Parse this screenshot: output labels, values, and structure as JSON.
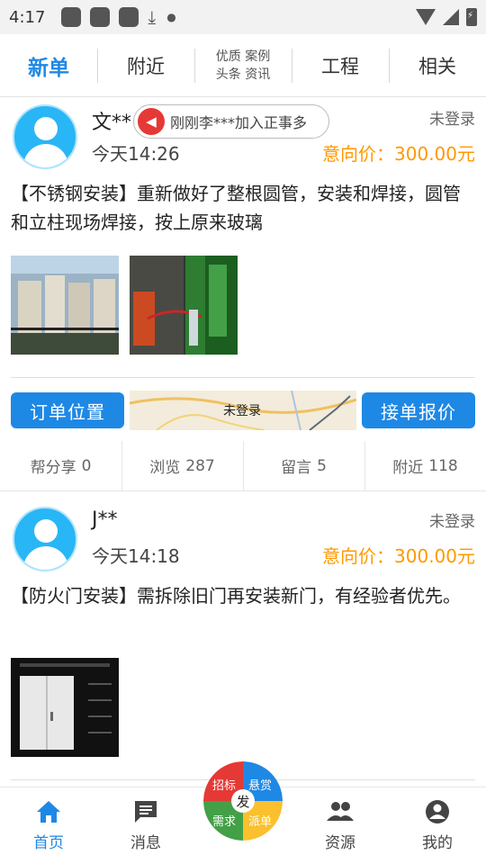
{
  "status_bar": {
    "time": "4:17"
  },
  "tabs": [
    {
      "label": "新单"
    },
    {
      "label": "附近"
    },
    {
      "line1": "优质 案例",
      "line2": "头条 资讯"
    },
    {
      "label": "工程"
    },
    {
      "label": "相关"
    }
  ],
  "notice": {
    "text": "刚刚李***加入正事多"
  },
  "posts": [
    {
      "username": "文**",
      "login_status": "未登录",
      "time": "今天14:26",
      "price": "意向价：300.00元",
      "description": "【不锈钢安装】重新做好了整根圆管，安装和焊接，圆管和立柱现场焊接，按上原来玻璃",
      "actions": {
        "location_button": "订单位置",
        "map_label": "未登录",
        "quote_button": "接单报价"
      },
      "stats": [
        {
          "label": "帮分享",
          "value": "0"
        },
        {
          "label": "浏览",
          "value": "287"
        },
        {
          "label": "留言",
          "value": "5"
        },
        {
          "label": "附近",
          "value": "118"
        }
      ]
    },
    {
      "username": "J**",
      "login_status": "未登录",
      "time": "今天14:18",
      "price": "意向价：300.00元",
      "description": "【防火门安装】需拆除旧门再安装新门，有经验者优先。"
    }
  ],
  "bottom_nav": [
    {
      "label": "首页",
      "icon": "home-icon"
    },
    {
      "label": "消息",
      "icon": "message-icon"
    },
    {
      "label": "资源",
      "icon": "people-icon"
    },
    {
      "label": "我的",
      "icon": "profile-icon"
    }
  ],
  "fab": {
    "center": "发",
    "segments": [
      "招标",
      "悬赏",
      "需求",
      "派单"
    ]
  },
  "colors": {
    "accent": "#1e88e5",
    "price": "#ff9800",
    "notice_speaker": "#e53935"
  }
}
